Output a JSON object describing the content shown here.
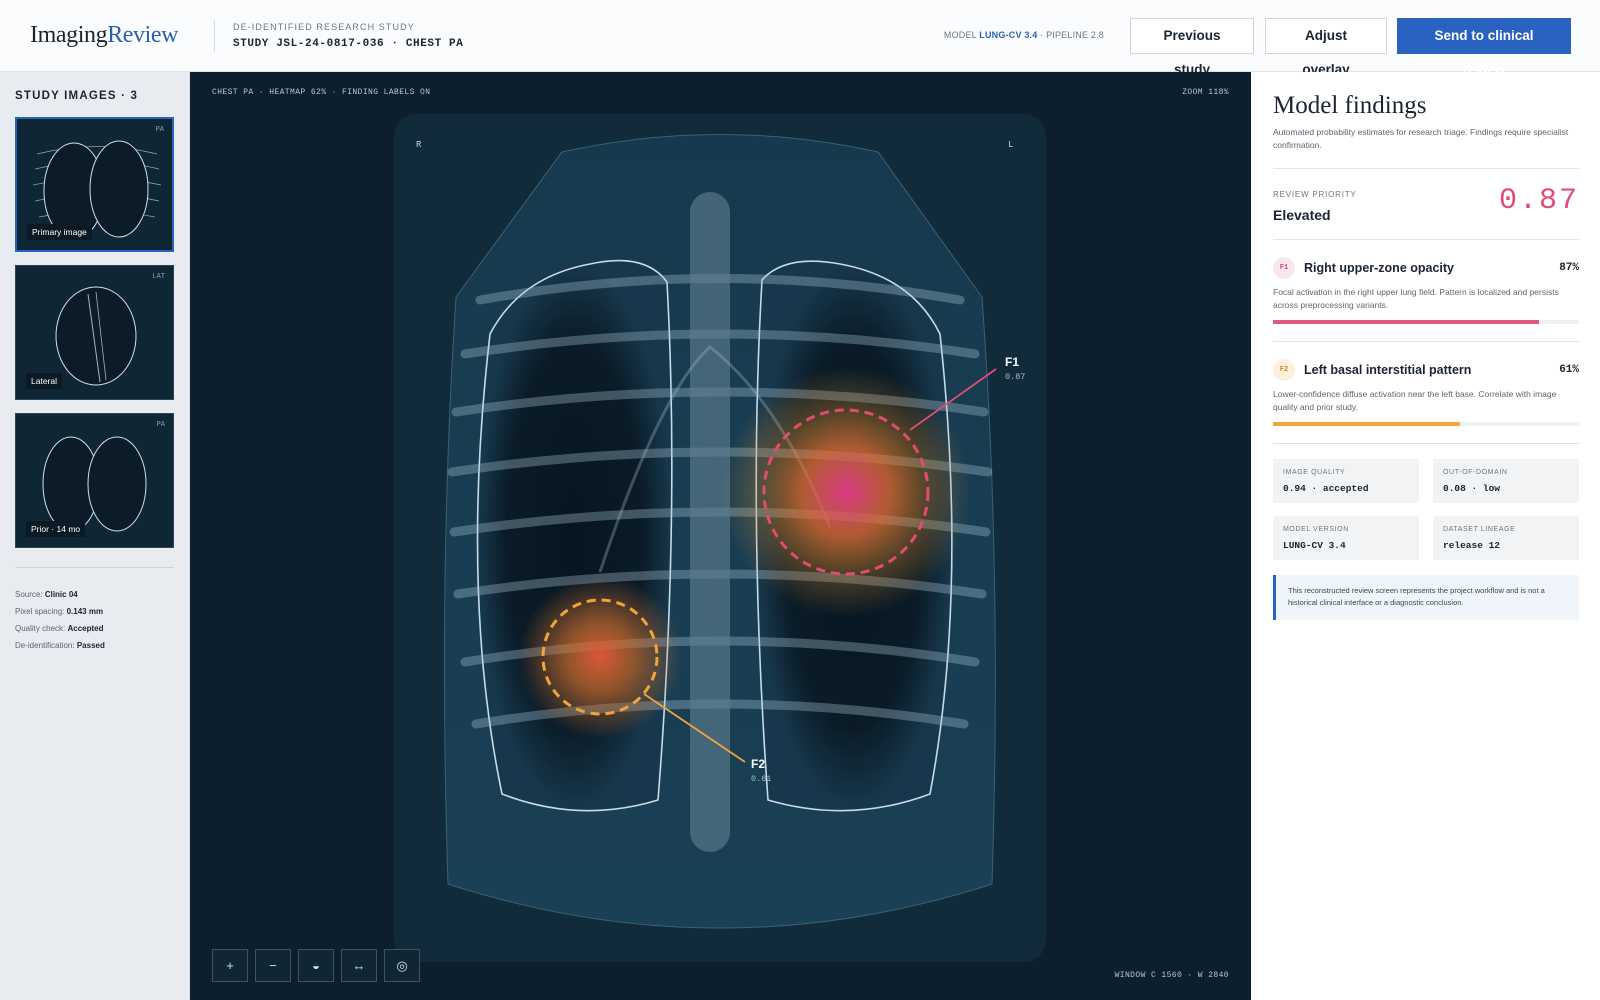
{
  "header": {
    "logo_main": "Imaging",
    "logo_accent": "Review",
    "kicker": "DE-IDENTIFIED RESEARCH STUDY",
    "study": "STUDY JSL-24-0817-036 · CHEST PA",
    "model_prefix": "MODEL",
    "model_version": "LUNG-CV 3.4",
    "pipeline": "· PIPELINE 2.8",
    "buttons": {
      "previous": "Previous study",
      "adjust": "Adjust overlay",
      "send": "Send to clinical review"
    }
  },
  "sidebar": {
    "title": "STUDY IMAGES · 3",
    "thumbnails": [
      {
        "tag": "PA",
        "label": "Primary image"
      },
      {
        "tag": "LAT",
        "label": "Lateral"
      },
      {
        "tag": "PA",
        "label": "Prior · 14 mo"
      }
    ],
    "meta": [
      {
        "key": "Source:",
        "value": "Clinic 04"
      },
      {
        "key": "Pixel spacing:",
        "value": "0.143 mm"
      },
      {
        "key": "Quality check:",
        "value": "Accepted"
      },
      {
        "key": "De-identification:",
        "value": "Passed"
      }
    ]
  },
  "viewer": {
    "info": "CHEST PA · HEATMAP 62% · FINDING LABELS ON",
    "zoom": "ZOOM 118%",
    "window": "WINDOW C 1560 · W 2840",
    "side_right": "R",
    "side_left": "L",
    "tools": [
      {
        "icon": "zoom-in-icon",
        "glyph": "+"
      },
      {
        "icon": "zoom-out-icon",
        "glyph": "−"
      },
      {
        "icon": "contrast-icon",
        "glyph": "◒"
      },
      {
        "icon": "flip-horizontal-icon",
        "glyph": "↔"
      },
      {
        "icon": "target-icon",
        "glyph": "◎"
      }
    ],
    "overlays": [
      {
        "label": "F1",
        "score": "0.87",
        "color": "#e14c76"
      },
      {
        "label": "F2",
        "score": "0.61",
        "color": "#f0a43a"
      }
    ]
  },
  "panel": {
    "title": "Model findings",
    "description": "Automated probability estimates for research triage. Findings require specialist confirmation.",
    "priority_kicker": "REVIEW PRIORITY",
    "priority_value": "Elevated",
    "priority_score": "0.87",
    "findings": [
      {
        "badge": "F1",
        "title": "Right upper-zone opacity",
        "pct": "87%",
        "probability": 0.87,
        "description": "Focal activation in the right upper lung field. Pattern is localized and persists across preprocessing variants.",
        "color": "#e0587d"
      },
      {
        "badge": "F2",
        "title": "Left basal interstitial pattern",
        "pct": "61%",
        "probability": 0.61,
        "description": "Lower-confidence diffuse activation near the left base. Correlate with image quality and prior study.",
        "color": "#f0a43a"
      }
    ],
    "cards": [
      {
        "key": "IMAGE QUALITY",
        "value": "0.94 · accepted"
      },
      {
        "key": "OUT-OF-DOMAIN",
        "value": "0.08 · low"
      },
      {
        "key": "MODEL VERSION",
        "value": "LUNG-CV 3.4"
      },
      {
        "key": "DATASET LINEAGE",
        "value": "release 12"
      }
    ],
    "note": "This reconstructed review screen represents the project workflow and is not a historical clinical interface or a diagnostic conclusion."
  }
}
